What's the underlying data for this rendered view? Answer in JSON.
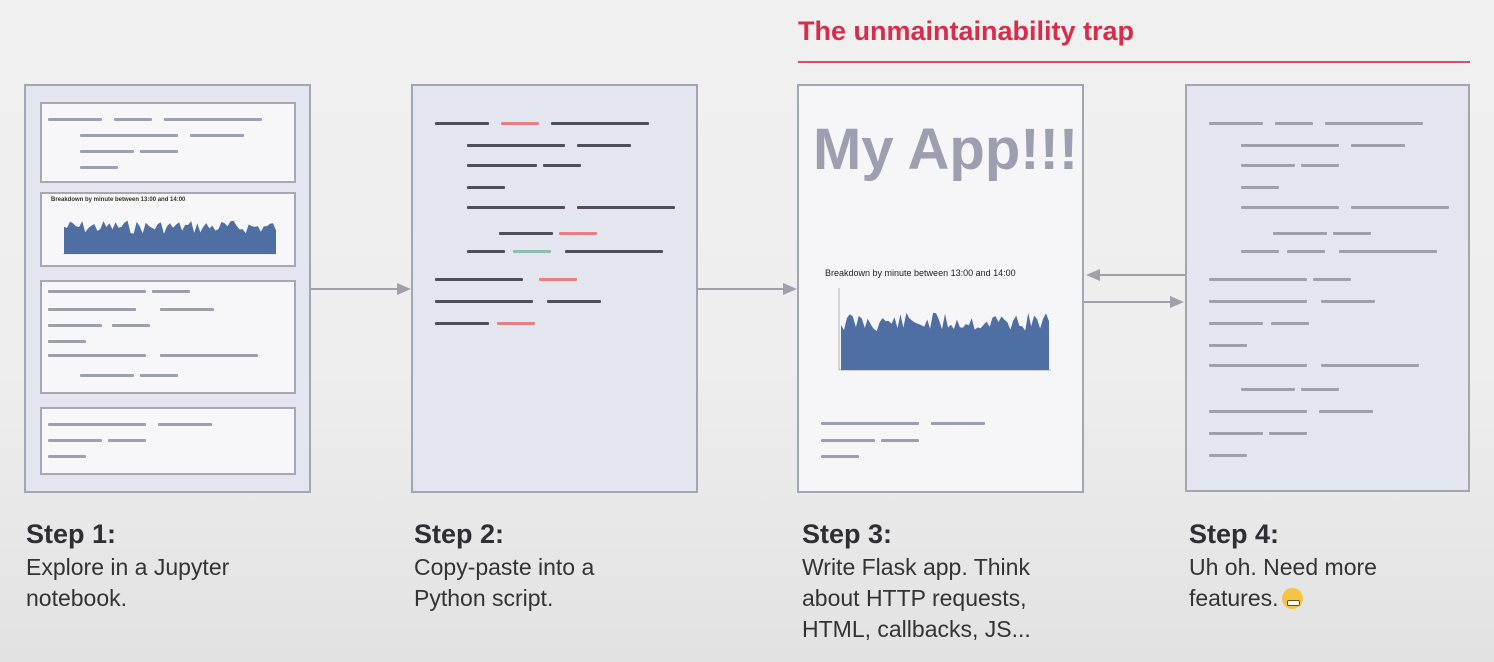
{
  "header": {
    "title": "The unmaintainability trap",
    "accent_color": "#d92c4a"
  },
  "mini_chart": {
    "title": "Breakdown by minute between 13:00 and 14:00"
  },
  "app_panel": {
    "title": "My App!!!"
  },
  "steps": [
    {
      "title": "Step 1:",
      "desc": "Explore in a Jupyter notebook."
    },
    {
      "title": "Step 2:",
      "desc": "Copy-paste into a Python script."
    },
    {
      "title": "Step 3:",
      "desc": "Write Flask app. Think about HTTP requests, HTML, callbacks, JS..."
    },
    {
      "title": "Step 4:",
      "desc": "Uh oh. Need more features."
    }
  ],
  "icons": [
    "right-arrow-icon",
    "left-arrow-icon",
    "grimacing-face-icon"
  ]
}
